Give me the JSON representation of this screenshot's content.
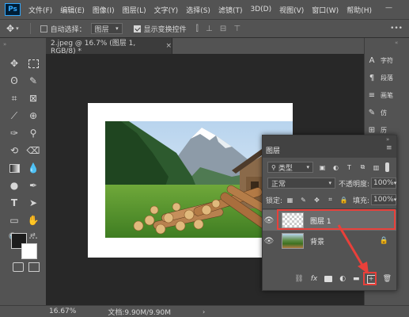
{
  "menubar": {
    "logo": "Ps",
    "items": [
      "文件(F)",
      "编辑(E)",
      "图像(I)",
      "图层(L)",
      "文字(Y)",
      "选择(S)",
      "滤镜(T)",
      "3D(D)",
      "视图(V)",
      "窗口(W)",
      "帮助(H)"
    ]
  },
  "options": {
    "auto_select_label": "自动选择：",
    "auto_select_target": "图层",
    "show_transform_label": "显示变换控件"
  },
  "document": {
    "tab_title": "2.jpeg @ 16.7% (图层 1, RGB/8) *"
  },
  "dock": {
    "items": [
      {
        "icon": "A",
        "label": "字符"
      },
      {
        "icon": "¶",
        "label": "段落"
      },
      {
        "icon": "≡",
        "label": "画笔"
      },
      {
        "icon": "✎",
        "label": "仿"
      },
      {
        "icon": "⊞",
        "label": "历"
      }
    ]
  },
  "layers_panel": {
    "title": "图层",
    "filter_label": "类型",
    "blend_mode": "正常",
    "opacity_label": "不透明度:",
    "opacity_value": "100%",
    "lock_label": "锁定:",
    "fill_label": "填充:",
    "fill_value": "100%",
    "layers": [
      {
        "name": "图层 1",
        "selected": true,
        "thumbnail": "transparent"
      },
      {
        "name": "背景",
        "selected": false,
        "thumbnail": "photo",
        "locked": true
      }
    ],
    "footer_icons": [
      "link",
      "fx",
      "mask",
      "adjustment",
      "group",
      "new-layer",
      "trash"
    ],
    "footer_fx": "fx"
  },
  "status": {
    "zoom": "16.67%",
    "doc_info": "文档:9.90M/9.90M"
  },
  "colors": {
    "accent_highlight": "#e8403a",
    "ps_logo_blue": "#31a8ff"
  }
}
